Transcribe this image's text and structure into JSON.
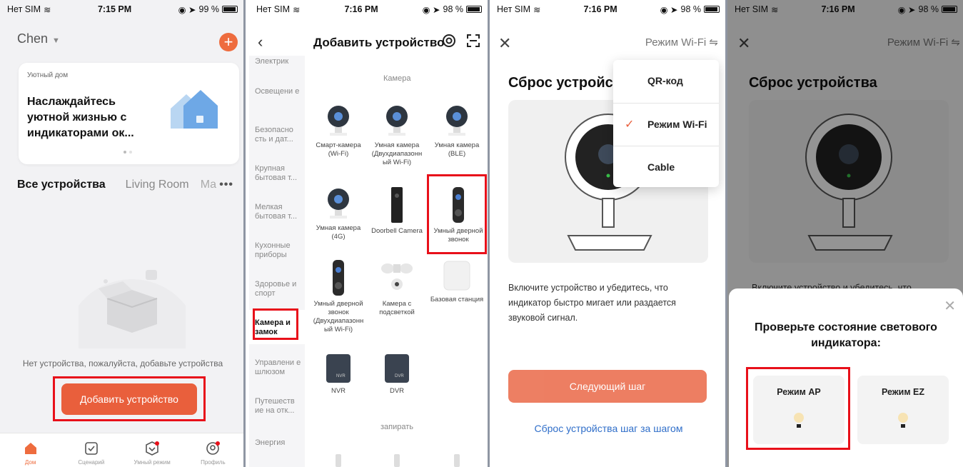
{
  "status": {
    "carrier": "Нет SIM",
    "panel1": {
      "time": "7:15 PM",
      "battery": "99 %"
    },
    "panel2": {
      "time": "7:16 PM",
      "battery": "98 %"
    },
    "panel3": {
      "time": "7:16 PM",
      "battery": "98 %"
    },
    "panel4": {
      "time": "7:16 PM",
      "battery": "98 %"
    }
  },
  "home": {
    "user": "Chen",
    "card_small": "Уютный дом",
    "card_title": "Наслаждайтесь уютной жизнью с индикаторами ок...",
    "tabs": {
      "all": "Все устройства",
      "living": "Living Room",
      "more_partial": "Ma",
      "more_dots": "•••"
    },
    "empty_text": "Нет устройства, пожалуйста, добавьте устройства",
    "add_button": "Добавить устройство",
    "nav": [
      {
        "label": "Дом",
        "icon": "home-icon",
        "active": true
      },
      {
        "label": "Сценарий",
        "icon": "checkbox-icon",
        "active": false
      },
      {
        "label": "Умный режим",
        "icon": "smart-icon",
        "active": false
      },
      {
        "label": "Профиль",
        "icon": "profile-icon",
        "active": false
      }
    ]
  },
  "add_device": {
    "title": "Добавить устройство",
    "categories": [
      "Электрик",
      "Освещени е",
      "Безопасно сть и дат...",
      "Крупная бытовая т...",
      "Мелкая бытовая т...",
      "Кухонные приборы",
      "Здоровье и спорт",
      "Камера и замок",
      "Управлени е шлюзом",
      "Путешеств ие на отк...",
      "Энергия"
    ],
    "section_camera": "Камера",
    "section_lock": "запирать",
    "devices": [
      "Смарт-камера (Wi-Fi)",
      "Умная камера (Двухдиапазонн ый Wi-Fi)",
      "Умная камера (BLE)",
      "Умная камера (4G)",
      "Doorbell Camera",
      "Умный дверной звонок",
      "Умный дверной звонок (Двухдиапазонн ый Wi-Fi)",
      "Камера с подсветкой",
      "Базовая станция",
      "NVR",
      "DVR"
    ],
    "nvr_tag": "NVR",
    "dvr_tag": "DVR"
  },
  "reset": {
    "mode_label": "Режим Wi-Fi ⇋",
    "title_cut": "Сброс устройст",
    "title": "Сброс устройства",
    "instructions": "Включите устройство и убедитесь, что индикатор быстро мигает или раздается звуковой сигнал.",
    "instructions_cut": "Включите устройство и убедитесь, что",
    "next_button": "Следующий шаг",
    "step_link": "Сброс устройства шаг за шагом",
    "dropdown": [
      "QR-код",
      "Режим Wi-Fi",
      "Cable"
    ]
  },
  "indicator": {
    "title": "Проверьте состояние светового индикатора:",
    "modes": [
      "Режим AP",
      "Режим EZ"
    ]
  },
  "colors": {
    "accent": "#e95f3c",
    "highlight": "#e8101a",
    "link": "#2f6ec9"
  }
}
